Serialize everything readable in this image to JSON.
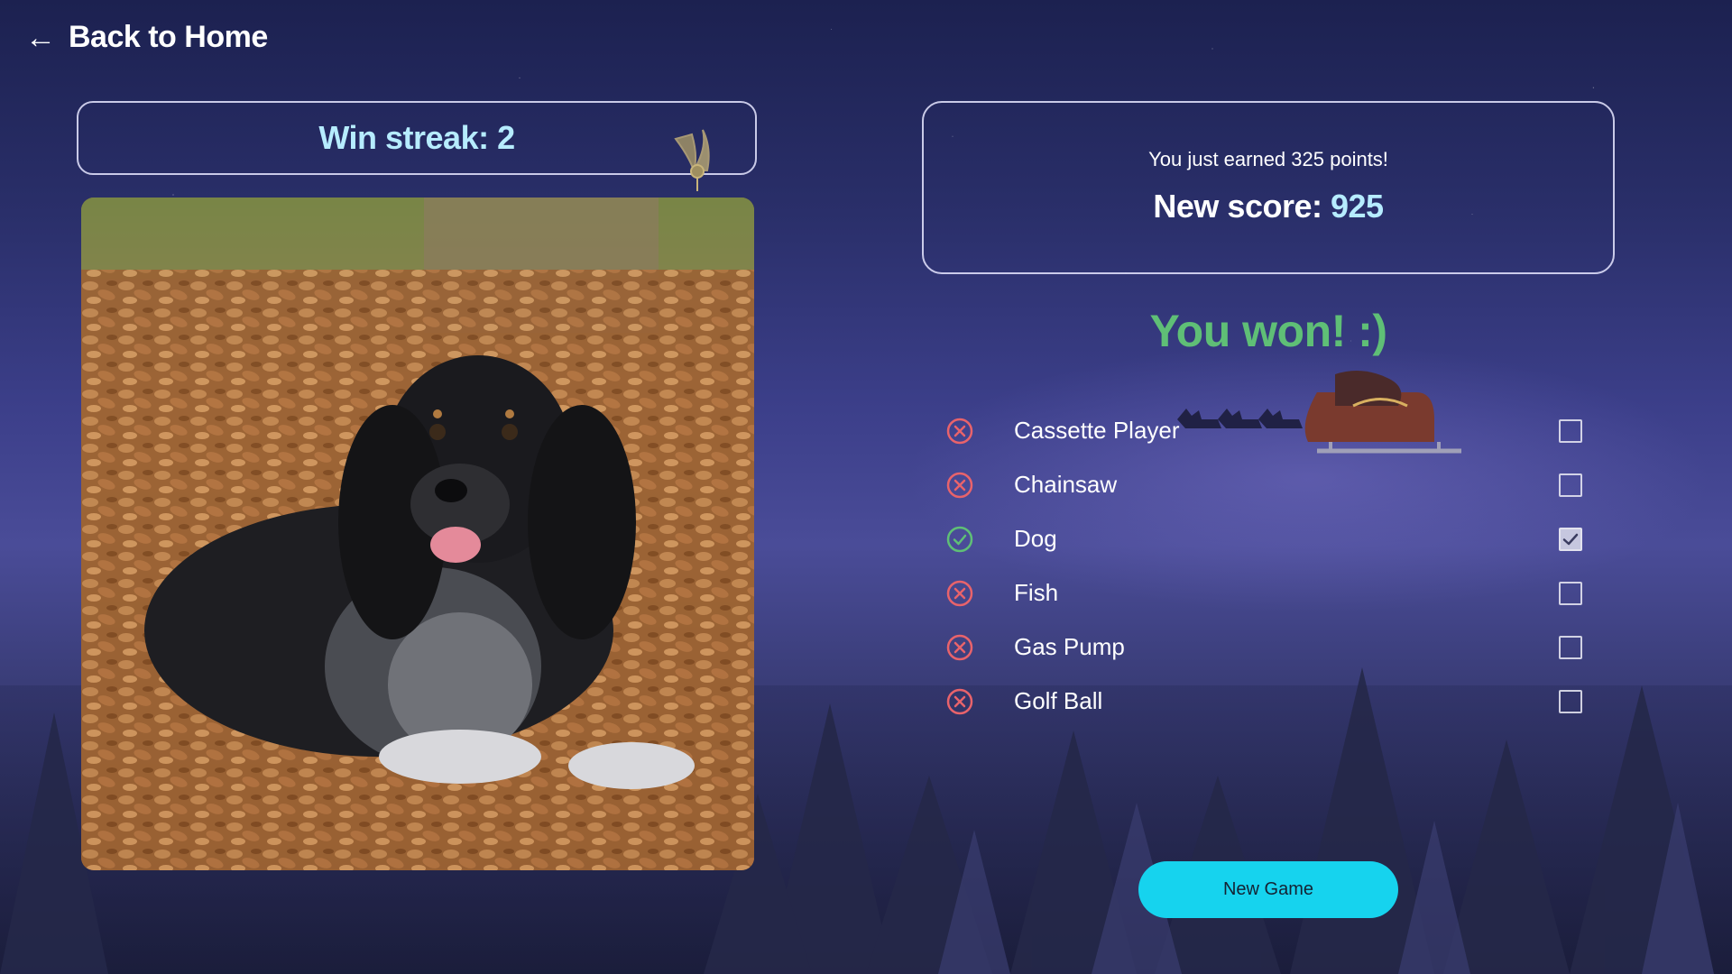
{
  "header": {
    "back_label": "Back to Home",
    "back_icon": "arrow-left-icon"
  },
  "streak": {
    "label": "Win streak: 2"
  },
  "photo": {
    "subject": "Dog"
  },
  "score": {
    "earned_text": "You just earned 325 points!",
    "new_score_label": "New score:",
    "new_score_value": "925"
  },
  "result_text": "You won! :)",
  "options": [
    {
      "label": "Cassette Player",
      "status": "wrong",
      "checked": false
    },
    {
      "label": "Chainsaw",
      "status": "wrong",
      "checked": false
    },
    {
      "label": "Dog",
      "status": "correct",
      "checked": true
    },
    {
      "label": "Fish",
      "status": "wrong",
      "checked": false
    },
    {
      "label": "Gas Pump",
      "status": "wrong",
      "checked": false
    },
    {
      "label": "Golf Ball",
      "status": "wrong",
      "checked": false
    }
  ],
  "new_game_label": "New Game",
  "colors": {
    "accent_cyan": "#16d3ee",
    "win_green": "#5fbf76",
    "wrong_red": "#e8636b",
    "correct_green": "#5fbf76",
    "highlight_text": "#b6ecff"
  }
}
